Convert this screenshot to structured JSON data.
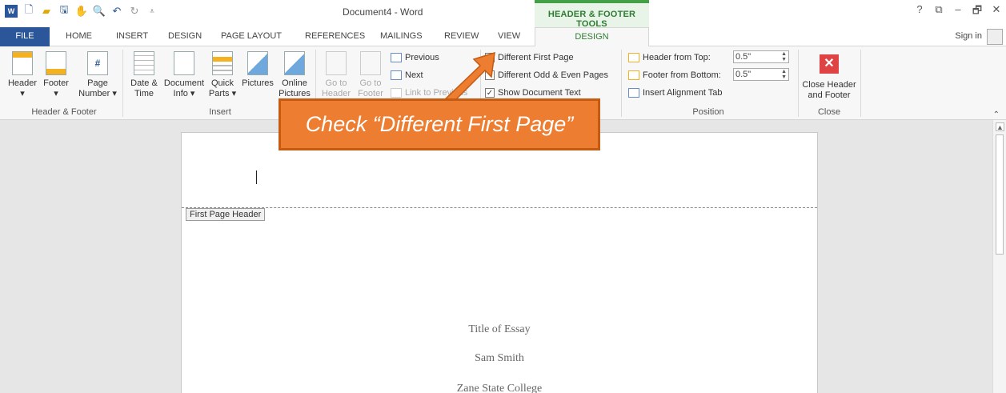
{
  "titlebar": {
    "doc_title": "Document4 - Word",
    "contextual_title": "HEADER & FOOTER TOOLS",
    "help": "?",
    "restore": "⧉",
    "minimize": "–",
    "maximize": "🗗",
    "close": "✕"
  },
  "tabs": {
    "file": "FILE",
    "home": "HOME",
    "insert": "INSERT",
    "design": "DESIGN",
    "page_layout": "PAGE LAYOUT",
    "references": "REFERENCES",
    "mailings": "MAILINGS",
    "review": "REVIEW",
    "view": "VIEW",
    "active_design": "DESIGN",
    "sign_in": "Sign in"
  },
  "ribbon": {
    "header": "Header",
    "footer": "Footer",
    "page_number": [
      "Page",
      "Number ▾"
    ],
    "group_header_footer": "Header & Footer",
    "date_time": [
      "Date &",
      "Time"
    ],
    "document_info": [
      "Document",
      "Info ▾"
    ],
    "quick_parts": [
      "Quick",
      "Parts ▾"
    ],
    "pictures": "Pictures",
    "online_pictures": [
      "Online",
      "Pictures"
    ],
    "group_insert": "Insert",
    "goto_header": [
      "Go to",
      "Header"
    ],
    "goto_footer": [
      "Go to",
      "Footer"
    ],
    "previous": "Previous",
    "next": "Next",
    "link_previous": "Link to Previous",
    "diff_first_page": "Different First Page",
    "diff_odd_even": "Different Odd & Even Pages",
    "show_doc_text": "Show Document Text",
    "header_from_top_label": "Header from Top:",
    "header_from_top_value": "0.5\"",
    "footer_from_bottom_label": "Footer from Bottom:",
    "footer_from_bottom_value": "0.5\"",
    "insert_alignment_tab": "Insert Alignment Tab",
    "group_position": "Position",
    "close_header_footer": [
      "Close Header",
      "and Footer"
    ],
    "group_close": "Close"
  },
  "document": {
    "header_tag": "First Page Header",
    "lines": [
      "Title of Essay",
      "Sam Smith",
      "Zane State College"
    ]
  },
  "callout": {
    "text": "Check “Different First Page”"
  },
  "colors": {
    "word_blue": "#2b579a",
    "contextual_green": "#2e7d32",
    "callout_orange": "#ed7d31"
  }
}
